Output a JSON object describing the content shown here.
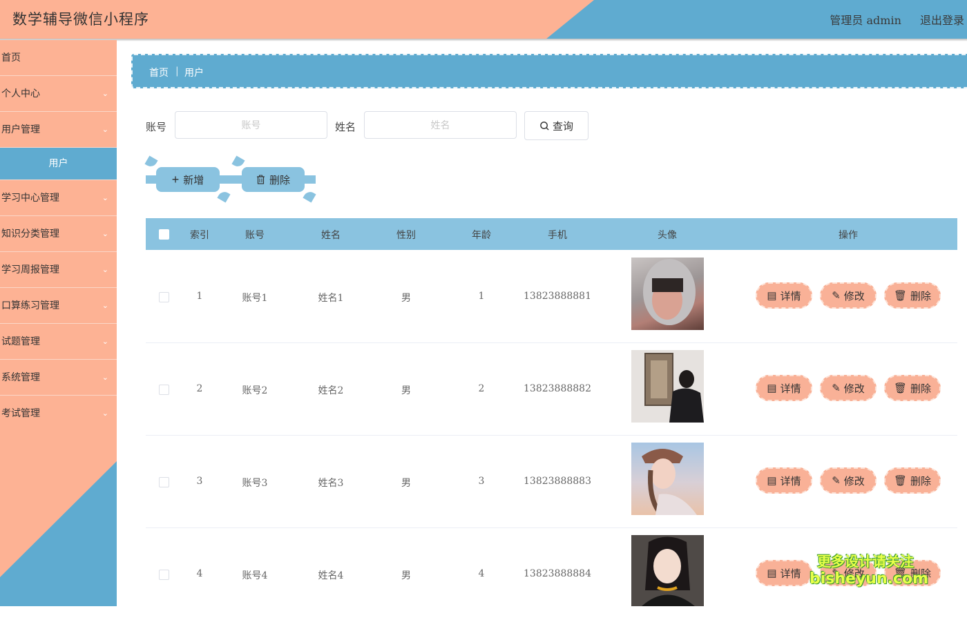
{
  "header": {
    "title": "数学辅导微信小程序",
    "admin": "管理员 admin",
    "logout": "退出登录"
  },
  "sidebar": {
    "items": [
      {
        "label": "首页",
        "chevron": false
      },
      {
        "label": "个人中心",
        "chevron": true
      },
      {
        "label": "用户管理",
        "chevron": true
      }
    ],
    "active_sub": "用户",
    "items2": [
      {
        "label": "学习中心管理"
      },
      {
        "label": "知识分类管理"
      },
      {
        "label": "学习周报管理"
      },
      {
        "label": "口算练习管理"
      },
      {
        "label": "试题管理"
      },
      {
        "label": "系统管理"
      },
      {
        "label": "考试管理"
      }
    ]
  },
  "breadcrumb": {
    "home": "首页",
    "sep": "|",
    "current": "用户"
  },
  "search": {
    "account_label": "账号",
    "account_placeholder": "账号",
    "name_label": "姓名",
    "name_placeholder": "姓名",
    "query_label": "查询"
  },
  "actions": {
    "add_label": "新增",
    "delete_label": "删除"
  },
  "table": {
    "columns": [
      "索引",
      "账号",
      "姓名",
      "性别",
      "年龄",
      "手机",
      "头像",
      "操作"
    ],
    "rows": [
      {
        "index": "1",
        "account": "账号1",
        "name": "姓名1",
        "gender": "男",
        "age": "1",
        "phone": "13823888881"
      },
      {
        "index": "2",
        "account": "账号2",
        "name": "姓名2",
        "gender": "男",
        "age": "2",
        "phone": "13823888882"
      },
      {
        "index": "3",
        "account": "账号3",
        "name": "姓名3",
        "gender": "男",
        "age": "3",
        "phone": "13823888883"
      },
      {
        "index": "4",
        "account": "账号4",
        "name": "姓名4",
        "gender": "男",
        "age": "4",
        "phone": "13823888884"
      }
    ],
    "row_actions": {
      "detail": "详情",
      "edit": "修改",
      "delete": "删除"
    }
  },
  "watermark": {
    "line1": "更多设计请关注",
    "line2": "bisheyun.com"
  },
  "colors": {
    "accent_blue": "#5fabd0",
    "accent_orange": "#fdb294",
    "table_header": "#8ac3e0"
  }
}
